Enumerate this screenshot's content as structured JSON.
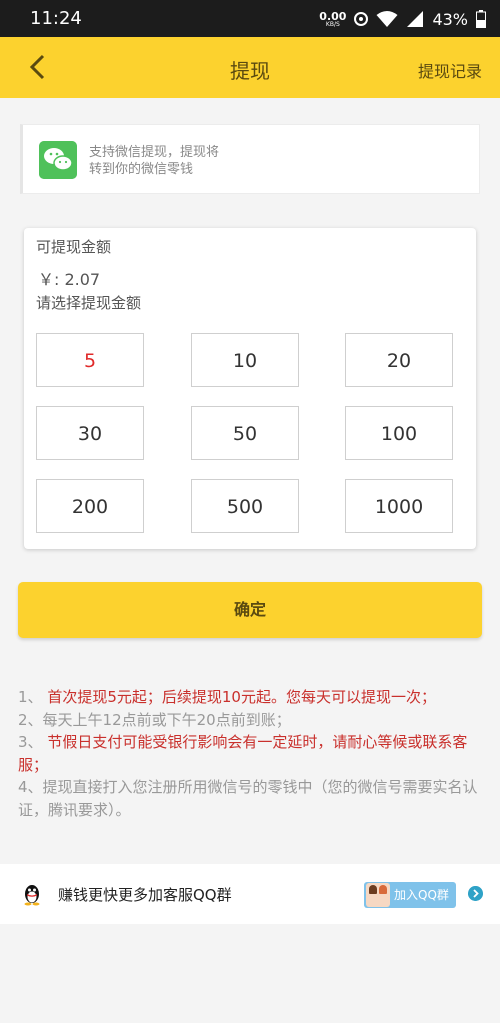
{
  "status_bar": {
    "time": "11:24",
    "net_speed": "0.00",
    "net_unit": "KB/S",
    "battery": "43%"
  },
  "header": {
    "title": "提现",
    "records": "提现记录"
  },
  "wechat_notice": {
    "line1": "支持微信提现，提现将",
    "line2": "转到你的微信零钱"
  },
  "card": {
    "available_label": "可提现金额",
    "balance": "￥: 2.07",
    "choose_label": "请选择提现金额",
    "selected": "5",
    "options": [
      "5",
      "10",
      "20",
      "30",
      "50",
      "100",
      "200",
      "500",
      "1000"
    ]
  },
  "confirm_label": "确定",
  "notes": [
    {
      "prefix": "1、 ",
      "text": "首次提现5元起；后续提现10元起。您每天可以提现一次；"
    },
    {
      "prefix": "2、",
      "text": "每天上午12点前或下午20点前到账；"
    },
    {
      "prefix": "3、 ",
      "text": "节假日支付可能受银行影响会有一定延时，请耐心等候或联系客服；"
    },
    {
      "prefix": "4、",
      "text": "提现直接打入您注册所用微信号的零钱中（您的微信号需要实名认证，腾讯要求）。"
    }
  ],
  "qq_bar": {
    "text": "赚钱更快更多加客服QQ群",
    "join_label": "加入QQ群"
  },
  "colors": {
    "accent": "#fcd22e",
    "selected_text": "#e02a2a",
    "note_red": "#c9302c",
    "wechat_green": "#4fc15a"
  },
  "icons": [
    "back-arrow-icon",
    "wechat-icon",
    "qq-penguin-icon",
    "chevron-right-icon",
    "wifi-icon",
    "signal-icon",
    "battery-icon"
  ]
}
